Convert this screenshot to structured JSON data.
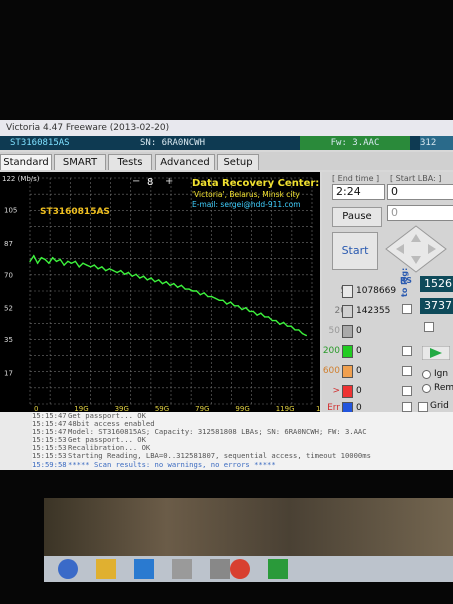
{
  "window": {
    "title": "Victoria 4.47 Freeware (2013-02-20)",
    "model": "ST3160815AS",
    "serial": "SN: 6RA0NCWH",
    "firmware": "Fw: 3.AAC",
    "capacity_cut": "312"
  },
  "tabs": [
    "Standard",
    "SMART",
    "Tests",
    "Advanced",
    "Setup"
  ],
  "plot": {
    "y_unit": "122 (Mb/s)",
    "y_ticks": [
      "105",
      "87",
      "70",
      "52",
      "35",
      "17"
    ],
    "x_ticks": [
      "0",
      "19G",
      "39G",
      "59G",
      "79G",
      "99G",
      "119G",
      "139G"
    ],
    "step_value": "8",
    "drive_label": "ST3160815AS",
    "banner_title": "Data Recovery Center:",
    "banner_line2": "'Victoria', Belarus, Minsk city",
    "banner_line3": "E-mail: sergei@hdd-911.com"
  },
  "chart_data": {
    "type": "line",
    "title": "",
    "xlabel": "",
    "ylabel": "(Mb/s)",
    "xlim": [
      0,
      149
    ],
    "ylim": [
      0,
      122
    ],
    "series": [
      {
        "x": [
          0,
          2,
          4,
          6,
          8,
          10,
          12,
          14,
          16,
          18,
          20,
          22,
          24,
          26,
          28,
          30,
          32,
          34,
          36,
          38,
          40,
          42,
          44,
          46,
          48,
          50,
          52,
          54,
          56,
          58,
          60,
          62,
          64,
          66,
          68,
          70,
          72,
          74,
          76,
          78,
          80,
          82,
          84,
          86,
          88,
          90,
          92,
          94,
          96,
          98,
          100,
          102,
          104,
          106,
          108,
          110,
          112,
          114,
          116,
          118,
          120,
          122,
          124,
          126,
          128,
          130,
          132,
          134,
          136,
          138,
          140,
          142,
          144,
          146
        ],
        "y": [
          77,
          80,
          76,
          79,
          78,
          76,
          79,
          77,
          78,
          75,
          77,
          76,
          77,
          74,
          76,
          75,
          74,
          75,
          73,
          74,
          72,
          73,
          72,
          71,
          72,
          70,
          71,
          69,
          70,
          68,
          69,
          67,
          68,
          66,
          67,
          65,
          66,
          64,
          65,
          63,
          64,
          62,
          62,
          61,
          61,
          59,
          60,
          58,
          58,
          57,
          56,
          56,
          54,
          55,
          53,
          53,
          51,
          52,
          50,
          50,
          48,
          49,
          47,
          47,
          45,
          45,
          43,
          44,
          42,
          42,
          40,
          40,
          38,
          37
        ]
      }
    ],
    "grid": true,
    "background": "#000000",
    "line_color": "#3df23d"
  },
  "panel": {
    "end_time_label": "[ End time ]",
    "start_lba_label": "[ Start LBA: ]",
    "end_time": "2:24",
    "start_lba": "0",
    "pause_label": "Pause",
    "start_label": "Start",
    "lba_field2": "0",
    "rs_label": "RS",
    "to_log_label": "to log:",
    "right_field1": "1526",
    "right_field2": "3737",
    "ignore_label": "Ign",
    "remap_label": "Rem",
    "grid_label": "Grid"
  },
  "blocks": [
    {
      "label": "5",
      "count": "1078669",
      "color": "#e8e8e8"
    },
    {
      "label": "20",
      "count": "142355",
      "color": "#d0d0d0"
    },
    {
      "label": "50",
      "count": "0",
      "color": "#a9a9a9"
    },
    {
      "label": "200",
      "count": "0",
      "color": "#22cc22"
    },
    {
      "label": "600",
      "count": "0",
      "color": "#f0a050"
    },
    {
      "label": ">",
      "count": "0",
      "color": "#ee3333"
    },
    {
      "label": "Err",
      "count": "0",
      "color": "#2255dd"
    }
  ],
  "log": [
    {
      "time": "15:15:47",
      "text": "Get passport... OK"
    },
    {
      "time": "15:15:47",
      "text": "48bit access enabled"
    },
    {
      "time": "15:15:47",
      "text": "Model: ST3160815AS; Capacity: 312581808 LBAs; SN: 6RA0NCWH; FW: 3.AAC"
    },
    {
      "time": "15:15:53",
      "text": "Get passport... OK"
    },
    {
      "time": "15:15:53",
      "text": "Recalibration... OK"
    },
    {
      "time": "15:15:53",
      "text": "Starting Reading, LBA=0..312581807, sequential access, timeout 10000ms"
    },
    {
      "time": "15:59:58",
      "text": "***** Scan results: no warnings, no errors *****"
    }
  ]
}
